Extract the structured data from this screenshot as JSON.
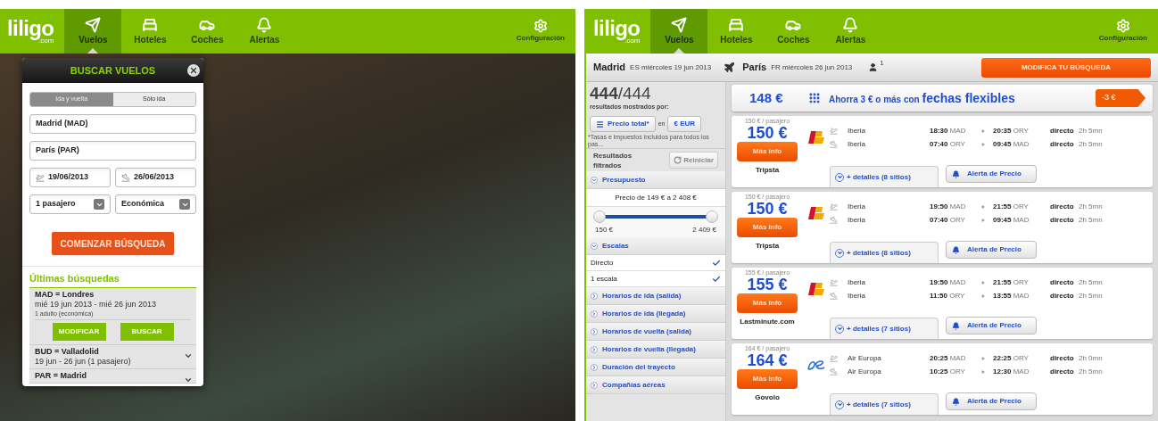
{
  "left_screen": {
    "nav": {
      "logo": "liligo",
      "logo_sub": ".com",
      "items": [
        {
          "label": "Vuelos",
          "selected": true
        },
        {
          "label": "Hoteles",
          "selected": false
        },
        {
          "label": "Coches",
          "selected": false
        },
        {
          "label": "Alertas",
          "selected": false
        }
      ],
      "settings": "Configuración"
    },
    "search_panel": {
      "title": "BUSCAR VUELOS",
      "trip_types": [
        {
          "label": "Ida y vuelta",
          "selected": true
        },
        {
          "label": "Sólo ida",
          "selected": false
        }
      ],
      "origin": "Madrid (MAD)",
      "destination": "París (PAR)",
      "departure_date": "19/06/2013",
      "return_date": "26/06/2013",
      "passengers": "1 pasajero",
      "cabin": "Económica",
      "submit": "COMENZAR BÚSQUEDA",
      "recent": {
        "title": "Últimas búsquedas",
        "items": [
          {
            "route": "MAD = Londres",
            "dates": "mié 19 jun 2013 - mié 26 jun 2013",
            "detail": "1 adulto (económica)",
            "expanded": true,
            "actions": [
              "MODIFICAR",
              "BUSCAR"
            ]
          },
          {
            "route": "BUD = Valladolid",
            "dates": "19 jun - 26 jun (1 pasajero)",
            "expanded": false
          },
          {
            "route": "PAR = Madrid",
            "expanded": false
          }
        ]
      }
    }
  },
  "right_screen": {
    "nav": {
      "logo": "liligo",
      "logo_sub": ".com",
      "items": [
        {
          "label": "Vuelos",
          "selected": true
        },
        {
          "label": "Hoteles",
          "selected": false
        },
        {
          "label": "Coches",
          "selected": false
        },
        {
          "label": "Alertas",
          "selected": false
        }
      ],
      "settings": "Configuración"
    },
    "summary": {
      "origin": "Madrid",
      "origin_detail": "ES miércoles 19 jun 2013",
      "destination": "París",
      "destination_detail": "FR miércoles 26 jun 2013",
      "passengers": "1",
      "button": "MODIFICA TU BÚSQUEDA"
    },
    "sidebar": {
      "count_shown": "444",
      "count_total": "/444",
      "shown_by": "resultados mostrados por:",
      "sort": "Precio total*",
      "joiner": "en",
      "currency": "€ EUR",
      "note": "*Tasas e impuestos incluidos para todos los pas...",
      "filtered": "Resultados filtrados",
      "reset": {
        "label": "Reiniciar",
        "disabled": true
      },
      "filters": [
        {
          "kind": "range",
          "label": "Presupuesto",
          "expanded": true,
          "range_text": "Precio de 149 € a 2 408 €",
          "level": 1,
          "min_label": "150 €",
          "max_label": "2 409 €"
        },
        {
          "kind": "options",
          "label": "Escalas",
          "expanded": true,
          "options": [
            {
              "label": "Directo",
              "checked": true
            },
            {
              "label": "1 escala",
              "checked": true
            }
          ]
        },
        {
          "label": "Horarios de ida (salida)",
          "expanded": false
        },
        {
          "label": "Horarios de ida (llegada)",
          "expanded": false
        },
        {
          "label": "Horarios de vuelta (salida)",
          "expanded": false
        },
        {
          "label": "Horarios de vuelta (llegada)",
          "expanded": false
        },
        {
          "label": "Duración del trayecto",
          "expanded": false
        },
        {
          "label": "Compañías aéreas",
          "expanded": false
        }
      ]
    },
    "flexible": {
      "price": "148 €",
      "text": "Ahorra 3 € o más con",
      "highlight": "fechas flexibles",
      "tag": "-3 €"
    },
    "results": [
      {
        "per_passenger": "150 € / pasajero",
        "price": "150 €",
        "button": "Más info",
        "site": "Tripsta",
        "logo": {
          "kind": "iberia"
        },
        "details": "+ detalles (8 sitios)",
        "alert": "Alerta de Precio",
        "legs": [
          {
            "airline": "Iberia",
            "dep_time": "18:30",
            "dep_code": "MAD",
            "arr_time": "20:35",
            "arr_code": "ORY",
            "stops": "directo",
            "duration": "2h 5mn"
          },
          {
            "airline": "Iberia",
            "dep_time": "07:40",
            "dep_code": "ORY",
            "arr_time": "09:45",
            "arr_code": "MAD",
            "stops": "directo",
            "duration": "2h 5mn"
          }
        ]
      },
      {
        "per_passenger": "150 € / pasajero",
        "price": "150 €",
        "button": "Más info",
        "site": "Tripsta",
        "logo": {
          "kind": "iberia"
        },
        "details": "+ detalles (8 sitios)",
        "alert": "Alerta de Precio",
        "legs": [
          {
            "airline": "Iberia",
            "dep_time": "19:50",
            "dep_code": "MAD",
            "arr_time": "21:55",
            "arr_code": "ORY",
            "stops": "directo",
            "duration": "2h 5mn"
          },
          {
            "airline": "Iberia",
            "dep_time": "07:40",
            "dep_code": "ORY",
            "arr_time": "09:45",
            "arr_code": "MAD",
            "stops": "directo",
            "duration": "2h 5mn"
          }
        ]
      },
      {
        "per_passenger": "155 € / pasajero",
        "price": "155 €",
        "button": "Más info",
        "site": "Lastminute.com",
        "logo": {
          "kind": "iberia"
        },
        "details": "+ detalles (7 sitios)",
        "alert": "Alerta de Precio",
        "legs": [
          {
            "airline": "Iberia",
            "dep_time": "19:50",
            "dep_code": "MAD",
            "arr_time": "21:55",
            "arr_code": "ORY",
            "stops": "directo",
            "duration": "2h 5mn"
          },
          {
            "airline": "Iberia",
            "dep_time": "11:50",
            "dep_code": "ORY",
            "arr_time": "13:55",
            "arr_code": "MAD",
            "stops": "directo",
            "duration": "2h 5mn"
          }
        ]
      },
      {
        "per_passenger": "164 € / pasajero",
        "price": "164 €",
        "button": "Más info",
        "site": "Govolo",
        "logo": {
          "kind": "aireuropa"
        },
        "details": "+ detalles (7 sitios)",
        "alert": "Alerta de Precio",
        "legs": [
          {
            "airline": "Air Europa",
            "dep_time": "20:25",
            "dep_code": "MAD",
            "arr_time": "22:25",
            "arr_code": "ORY",
            "stops": "directo",
            "duration": "2h 0mn"
          },
          {
            "airline": "Air Europa",
            "dep_time": "10:25",
            "dep_code": "ORY",
            "arr_time": "12:30",
            "arr_code": "MAD",
            "stops": "directo",
            "duration": "2h 5mn"
          }
        ]
      }
    ]
  }
}
